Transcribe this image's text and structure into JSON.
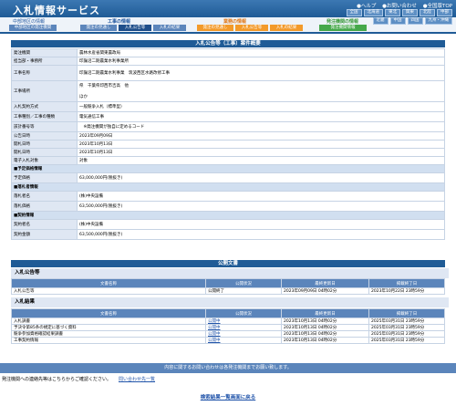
{
  "header": {
    "title": "入札情報サービス",
    "util": [
      "●ヘルプ",
      "●お問い合わせ",
      "●全国版TOP"
    ],
    "regions_top": [
      "全国",
      "北海道",
      "東北",
      "関東",
      "北陸",
      "中部",
      "近畿",
      "中国",
      "四国",
      "九州・沖縄"
    ],
    "regions_bottom": [
      "近畿",
      "中国",
      "四国",
      "九州・沖縄"
    ]
  },
  "nav": {
    "top_left": "中部地区の情報",
    "groups": [
      {
        "label": "工事の情報"
      },
      {
        "label": "業務の情報"
      },
      {
        "label": "発注機関の情報"
      }
    ],
    "tabs": [
      "中部地区の発注機関",
      "発注の見通し",
      "入札公告等",
      "入札の結果",
      "発注の見通し",
      "入札公告等",
      "入札の結果",
      "発注機関情報"
    ]
  },
  "case": {
    "heading": "入札公告等（工事）案件概要",
    "rows": [
      {
        "label": "発注機関",
        "value": "農林水産省関東農政局"
      },
      {
        "label": "担当部・事務所",
        "value": "印旛沼二期農業水利事業所"
      },
      {
        "label": "工事名称",
        "value": "印旛沼二期農業水利事業　筑波西区水路改修工事"
      },
      {
        "label": "工事場所",
        "value": "県　千葉県印西市吉高　他",
        "extra": "ほか"
      },
      {
        "label": "入札契約方式",
        "value": "一般競争入札（標準型）"
      },
      {
        "label": "工事種別／工事の種類",
        "value": "電気通信工事"
      },
      {
        "label": "該計番号等",
        "value": "　※発注機関が独自に定めるコード"
      },
      {
        "label": "公告日時",
        "value": "2023年09月09日"
      },
      {
        "label": "開札日時",
        "value": "2023年10月13日"
      },
      {
        "label": "開札日時",
        "value": "2023年10月13日"
      },
      {
        "label": "電子入札対象",
        "value": "対象"
      }
    ],
    "sections": {
      "estimate": {
        "label": "■予定価格情報",
        "rows": [
          {
            "label": "予定価格",
            "value": "63,000,000円(税抜き)"
          }
        ]
      },
      "winner": {
        "label": "■落札者情報",
        "rows": [
          {
            "label": "落札者名",
            "value": "(株)中央設備"
          },
          {
            "label": "落札価格",
            "value": "63,500,000円(税抜き)"
          }
        ]
      },
      "contract": {
        "label": "■契約情報",
        "rows": [
          {
            "label": "契約者名",
            "value": "(株)中央設備"
          },
          {
            "label": "契約金額",
            "value": "63,500,000円(税抜き)"
          }
        ]
      }
    }
  },
  "public_docs": {
    "heading": "公開文書",
    "notice": {
      "title": "入札公告等",
      "columns": [
        "文書名称",
        "公開状況",
        "最終更新日",
        "掲載終了日"
      ],
      "rows": [
        [
          "入札公告等",
          "公開終了",
          "2023年09月09日 04時02分",
          "2023年10月22日 23時59分"
        ]
      ]
    },
    "results": {
      "title": "入札結果",
      "columns": [
        "文書名称",
        "公開状況",
        "最終更新日",
        "掲載終了日"
      ],
      "rows": [
        [
          "入札調書",
          "公開中",
          "2023年10月13日 04時02分",
          "2025年03月31日 23時59分"
        ],
        [
          "予決令第85条の規定に基づく資料",
          "公開中",
          "2023年10月13日 04時02分",
          "2025年03月31日 23時59分"
        ],
        [
          "競争参加資格確認結果調書",
          "公開中",
          "2023年10月13日 04時02分",
          "2025年03月31日 23時59分"
        ],
        [
          "工事契約情報",
          "公開中",
          "2023年10月13日 04時02分",
          "2025年03月31日 23時59分"
        ]
      ]
    }
  },
  "footer": {
    "bar": "内容に関するお問い合わせは各発注機関までお願い致します。",
    "note": "発注機関への連絡先等はこちらからご確認ください。",
    "contact_link": "問い合わせ先一覧",
    "back_link": "検索結果一覧画面に戻る"
  },
  "colors": {
    "primary": "#1f5b96",
    "table_label": "#dfe7f3",
    "orange": "#f39a2a",
    "green": "#45a84a"
  }
}
